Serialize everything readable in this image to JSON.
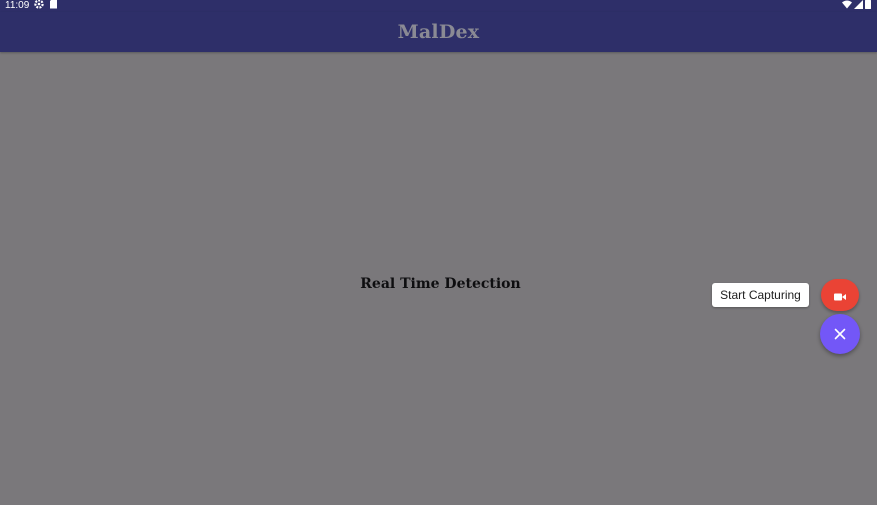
{
  "status_bar": {
    "time": "11:09",
    "icons": [
      "settings-icon",
      "sd-card-icon",
      "wifi-icon",
      "signal-icon",
      "battery-icon"
    ]
  },
  "app_bar": {
    "title": "MalDex"
  },
  "main": {
    "heading": "Real Time Detection"
  },
  "fab_menu": {
    "capture_label": "Start Capturing",
    "capture_icon": "videocam-icon",
    "close_icon": "close-icon",
    "colors": {
      "capture": "#ea4335",
      "main": "#7357f7"
    }
  },
  "colors": {
    "app_bar": "#2e2f69",
    "scrim_background": "#7a787b"
  }
}
